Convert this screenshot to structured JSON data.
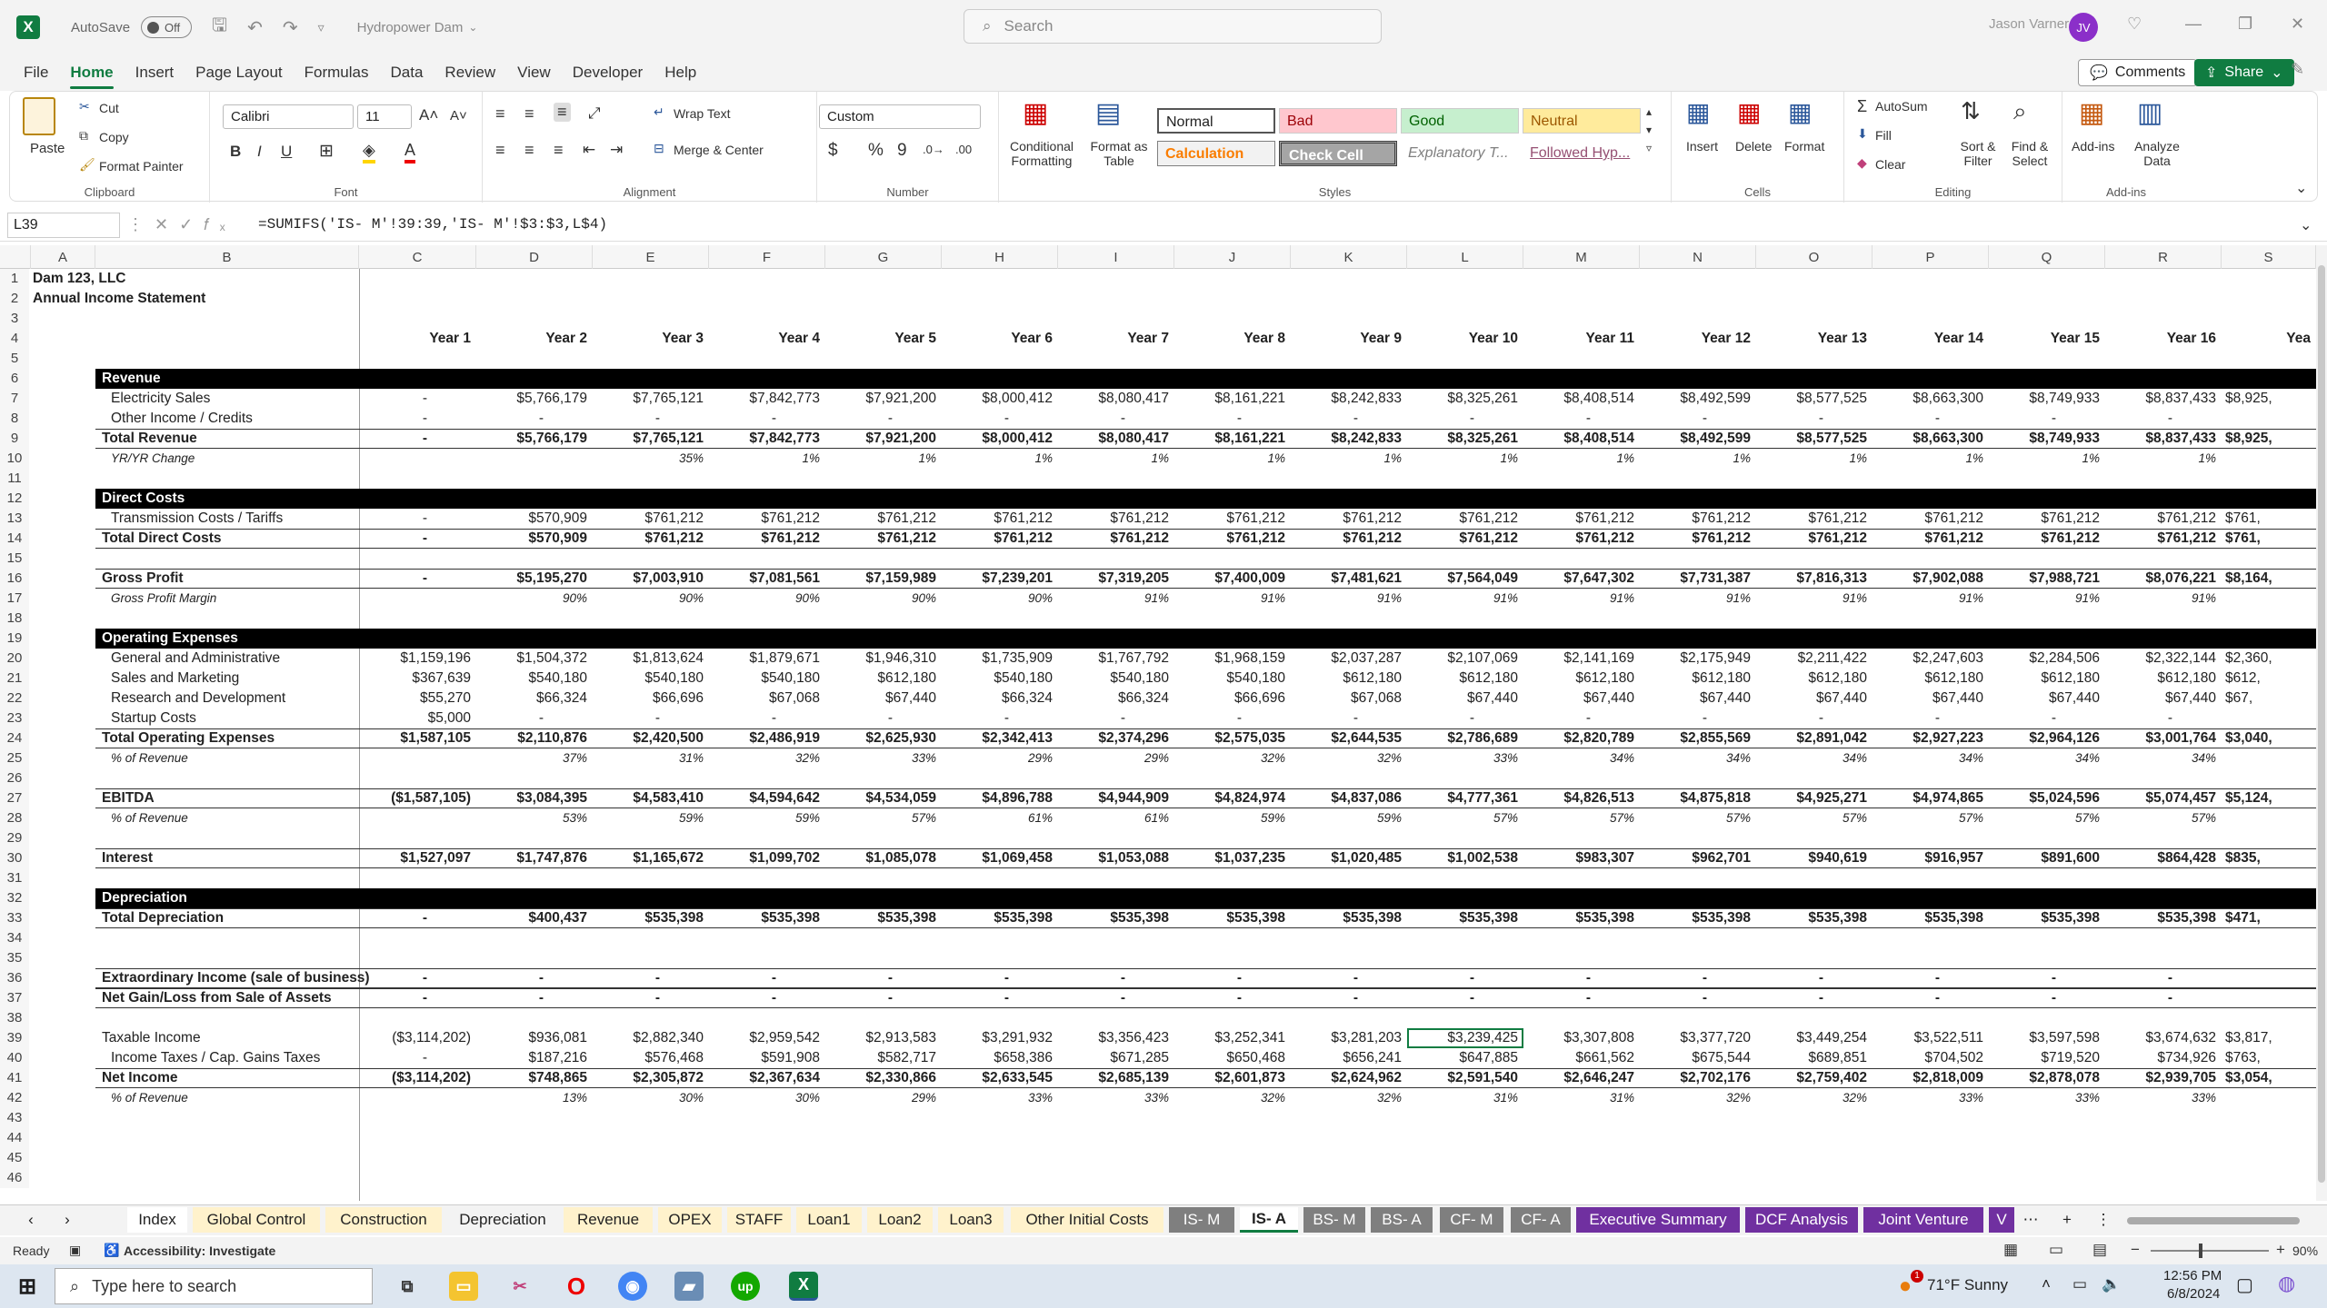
{
  "titlebar": {
    "autosave": "AutoSave",
    "toggle": "Off",
    "doc_title": "Hydropower Dam",
    "search": "Search",
    "user": "Jason Varner",
    "initials": "JV"
  },
  "menu": [
    "File",
    "Home",
    "Insert",
    "Page Layout",
    "Formulas",
    "Data",
    "Review",
    "View",
    "Developer",
    "Help"
  ],
  "menu_right": {
    "comments": "Comments",
    "share": "Share"
  },
  "ribbon": {
    "clipboard": {
      "paste": "Paste",
      "cut": "Cut",
      "copy": "Copy",
      "format_painter": "Format Painter",
      "label": "Clipboard"
    },
    "font": {
      "name": "Calibri",
      "size": "11",
      "label": "Font"
    },
    "alignment": {
      "wrap": "Wrap Text",
      "merge": "Merge & Center",
      "label": "Alignment"
    },
    "number": {
      "format": "Custom",
      "label": "Number"
    },
    "styles": {
      "cond": "Conditional Formatting",
      "table": "Format as Table",
      "normal": "Normal",
      "bad": "Bad",
      "good": "Good",
      "neutral": "Neutral",
      "calculation": "Calculation",
      "check": "Check Cell",
      "explanatory": "Explanatory T...",
      "followed": "Followed Hyp...",
      "label": "Styles"
    },
    "cells": {
      "insert": "Insert",
      "delete": "Delete",
      "format": "Format",
      "label": "Cells"
    },
    "editing": {
      "autosum": "AutoSum",
      "fill": "Fill",
      "clear": "Clear",
      "sort": "Sort & Filter",
      "find": "Find & Select",
      "label": "Editing"
    },
    "addins": {
      "addins": "Add-ins",
      "analyze": "Analyze Data",
      "label": "Add-ins"
    }
  },
  "formula_bar": {
    "name_box": "L39",
    "formula": "=SUMIFS('IS- M'!39:39,'IS- M'!$3:$3,L$4)"
  },
  "columns": [
    "A",
    "B",
    "C",
    "D",
    "E",
    "F",
    "G",
    "H",
    "I",
    "J",
    "K",
    "L",
    "M",
    "N",
    "O",
    "P",
    "Q",
    "R",
    "S"
  ],
  "sheet": {
    "title1": "Dam 123, LLC",
    "title2": "Annual Income Statement",
    "years": [
      "Year 1",
      "Year 2",
      "Year 3",
      "Year 4",
      "Year 5",
      "Year 6",
      "Year 7",
      "Year 8",
      "Year 9",
      "Year 10",
      "Year 11",
      "Year 12",
      "Year 13",
      "Year 14",
      "Year 15",
      "Year 16",
      "Yea"
    ],
    "rows": [
      {
        "r": 6,
        "label": "Revenue",
        "kind": "header"
      },
      {
        "r": 7,
        "label": "Electricity Sales",
        "kind": "indent",
        "v": [
          "-",
          "$5,766,179",
          "$7,765,121",
          "$7,842,773",
          "$7,921,200",
          "$8,000,412",
          "$8,080,417",
          "$8,161,221",
          "$8,242,833",
          "$8,325,261",
          "$8,408,514",
          "$8,492,599",
          "$8,577,525",
          "$8,663,300",
          "$8,749,933",
          "$8,837,433",
          "$8,925,"
        ]
      },
      {
        "r": 8,
        "label": "Other Income / Credits",
        "kind": "indent",
        "v": [
          "-",
          "-",
          "-",
          "-",
          "-",
          "-",
          "-",
          "-",
          "-",
          "-",
          "-",
          "-",
          "-",
          "-",
          "-",
          "-",
          ""
        ]
      },
      {
        "r": 9,
        "label": "Total Revenue",
        "kind": "total",
        "v": [
          "-",
          "$5,766,179",
          "$7,765,121",
          "$7,842,773",
          "$7,921,200",
          "$8,000,412",
          "$8,080,417",
          "$8,161,221",
          "$8,242,833",
          "$8,325,261",
          "$8,408,514",
          "$8,492,599",
          "$8,577,525",
          "$8,663,300",
          "$8,749,933",
          "$8,837,433",
          "$8,925,"
        ]
      },
      {
        "r": 10,
        "label": "YR/YR Change",
        "kind": "pct",
        "v": [
          "",
          "",
          "35%",
          "1%",
          "1%",
          "1%",
          "1%",
          "1%",
          "1%",
          "1%",
          "1%",
          "1%",
          "1%",
          "1%",
          "1%",
          "1%",
          ""
        ]
      },
      {
        "r": 12,
        "label": "Direct Costs",
        "kind": "header"
      },
      {
        "r": 13,
        "label": "Transmission Costs / Tariffs",
        "kind": "indent",
        "v": [
          "-",
          "$570,909",
          "$761,212",
          "$761,212",
          "$761,212",
          "$761,212",
          "$761,212",
          "$761,212",
          "$761,212",
          "$761,212",
          "$761,212",
          "$761,212",
          "$761,212",
          "$761,212",
          "$761,212",
          "$761,212",
          "$761,"
        ]
      },
      {
        "r": 14,
        "label": "Total Direct Costs",
        "kind": "total",
        "v": [
          "-",
          "$570,909",
          "$761,212",
          "$761,212",
          "$761,212",
          "$761,212",
          "$761,212",
          "$761,212",
          "$761,212",
          "$761,212",
          "$761,212",
          "$761,212",
          "$761,212",
          "$761,212",
          "$761,212",
          "$761,212",
          "$761,"
        ]
      },
      {
        "r": 16,
        "label": "Gross Profit",
        "kind": "total",
        "v": [
          "-",
          "$5,195,270",
          "$7,003,910",
          "$7,081,561",
          "$7,159,989",
          "$7,239,201",
          "$7,319,205",
          "$7,400,009",
          "$7,481,621",
          "$7,564,049",
          "$7,647,302",
          "$7,731,387",
          "$7,816,313",
          "$7,902,088",
          "$7,988,721",
          "$8,076,221",
          "$8,164,"
        ]
      },
      {
        "r": 17,
        "label": "Gross Profit Margin",
        "kind": "pct",
        "v": [
          "",
          "90%",
          "90%",
          "90%",
          "90%",
          "90%",
          "91%",
          "91%",
          "91%",
          "91%",
          "91%",
          "91%",
          "91%",
          "91%",
          "91%",
          "91%",
          ""
        ]
      },
      {
        "r": 19,
        "label": "Operating Expenses",
        "kind": "header"
      },
      {
        "r": 20,
        "label": "General and Administrative",
        "kind": "indent",
        "v": [
          "$1,159,196",
          "$1,504,372",
          "$1,813,624",
          "$1,879,671",
          "$1,946,310",
          "$1,735,909",
          "$1,767,792",
          "$1,968,159",
          "$2,037,287",
          "$2,107,069",
          "$2,141,169",
          "$2,175,949",
          "$2,211,422",
          "$2,247,603",
          "$2,284,506",
          "$2,322,144",
          "$2,360,"
        ]
      },
      {
        "r": 21,
        "label": "Sales and Marketing",
        "kind": "indent",
        "v": [
          "$367,639",
          "$540,180",
          "$540,180",
          "$540,180",
          "$612,180",
          "$540,180",
          "$540,180",
          "$540,180",
          "$612,180",
          "$612,180",
          "$612,180",
          "$612,180",
          "$612,180",
          "$612,180",
          "$612,180",
          "$612,180",
          "$612,"
        ]
      },
      {
        "r": 22,
        "label": "Research and Development",
        "kind": "indent",
        "v": [
          "$55,270",
          "$66,324",
          "$66,696",
          "$67,068",
          "$67,440",
          "$66,324",
          "$66,324",
          "$66,696",
          "$67,068",
          "$67,440",
          "$67,440",
          "$67,440",
          "$67,440",
          "$67,440",
          "$67,440",
          "$67,440",
          "$67,"
        ]
      },
      {
        "r": 23,
        "label": "Startup Costs",
        "kind": "indent",
        "v": [
          "$5,000",
          "-",
          "-",
          "-",
          "-",
          "-",
          "-",
          "-",
          "-",
          "-",
          "-",
          "-",
          "-",
          "-",
          "-",
          "-",
          ""
        ]
      },
      {
        "r": 24,
        "label": "Total Operating Expenses",
        "kind": "total",
        "v": [
          "$1,587,105",
          "$2,110,876",
          "$2,420,500",
          "$2,486,919",
          "$2,625,930",
          "$2,342,413",
          "$2,374,296",
          "$2,575,035",
          "$2,644,535",
          "$2,786,689",
          "$2,820,789",
          "$2,855,569",
          "$2,891,042",
          "$2,927,223",
          "$2,964,126",
          "$3,001,764",
          "$3,040,"
        ]
      },
      {
        "r": 25,
        "label": "% of Revenue",
        "kind": "pct",
        "v": [
          "",
          "37%",
          "31%",
          "32%",
          "33%",
          "29%",
          "29%",
          "32%",
          "32%",
          "33%",
          "34%",
          "34%",
          "34%",
          "34%",
          "34%",
          "34%",
          ""
        ]
      },
      {
        "r": 27,
        "label": "EBITDA",
        "kind": "total",
        "v": [
          "($1,587,105)",
          "$3,084,395",
          "$4,583,410",
          "$4,594,642",
          "$4,534,059",
          "$4,896,788",
          "$4,944,909",
          "$4,824,974",
          "$4,837,086",
          "$4,777,361",
          "$4,826,513",
          "$4,875,818",
          "$4,925,271",
          "$4,974,865",
          "$5,024,596",
          "$5,074,457",
          "$5,124,"
        ]
      },
      {
        "r": 28,
        "label": "% of Revenue",
        "kind": "pct",
        "v": [
          "",
          "53%",
          "59%",
          "59%",
          "57%",
          "61%",
          "61%",
          "59%",
          "59%",
          "57%",
          "57%",
          "57%",
          "57%",
          "57%",
          "57%",
          "57%",
          ""
        ]
      },
      {
        "r": 30,
        "label": "Interest",
        "kind": "total",
        "v": [
          "$1,527,097",
          "$1,747,876",
          "$1,165,672",
          "$1,099,702",
          "$1,085,078",
          "$1,069,458",
          "$1,053,088",
          "$1,037,235",
          "$1,020,485",
          "$1,002,538",
          "$983,307",
          "$962,701",
          "$940,619",
          "$916,957",
          "$891,600",
          "$864,428",
          "$835,"
        ]
      },
      {
        "r": 32,
        "label": "Depreciation",
        "kind": "header"
      },
      {
        "r": 33,
        "label": "Total Depreciation",
        "kind": "total",
        "v": [
          "-",
          "$400,437",
          "$535,398",
          "$535,398",
          "$535,398",
          "$535,398",
          "$535,398",
          "$535,398",
          "$535,398",
          "$535,398",
          "$535,398",
          "$535,398",
          "$535,398",
          "$535,398",
          "$535,398",
          "$535,398",
          "$471,"
        ]
      },
      {
        "r": 36,
        "label": "Extraordinary Income (sale of business)",
        "kind": "total",
        "v": [
          "-",
          "-",
          "-",
          "-",
          "-",
          "-",
          "-",
          "-",
          "-",
          "-",
          "-",
          "-",
          "-",
          "-",
          "-",
          "-",
          ""
        ]
      },
      {
        "r": 37,
        "label": "Net Gain/Loss from Sale of Assets",
        "kind": "total",
        "v": [
          "-",
          "-",
          "-",
          "-",
          "-",
          "-",
          "-",
          "-",
          "-",
          "-",
          "-",
          "-",
          "-",
          "-",
          "-",
          "-",
          ""
        ]
      },
      {
        "r": 39,
        "label": "Taxable Income",
        "kind": "plain",
        "v": [
          "($3,114,202)",
          "$936,081",
          "$2,882,340",
          "$2,959,542",
          "$2,913,583",
          "$3,291,932",
          "$3,356,423",
          "$3,252,341",
          "$3,281,203",
          "$3,239,425",
          "$3,307,808",
          "$3,377,720",
          "$3,449,254",
          "$3,522,511",
          "$3,597,598",
          "$3,674,632",
          "$3,817,"
        ]
      },
      {
        "r": 40,
        "label": "Income Taxes / Cap. Gains Taxes",
        "kind": "indent",
        "v": [
          "-",
          "$187,216",
          "$576,468",
          "$591,908",
          "$582,717",
          "$658,386",
          "$671,285",
          "$650,468",
          "$656,241",
          "$647,885",
          "$661,562",
          "$675,544",
          "$689,851",
          "$704,502",
          "$719,520",
          "$734,926",
          "$763,"
        ]
      },
      {
        "r": 41,
        "label": "Net Income",
        "kind": "total",
        "v": [
          "($3,114,202)",
          "$748,865",
          "$2,305,872",
          "$2,367,634",
          "$2,330,866",
          "$2,633,545",
          "$2,685,139",
          "$2,601,873",
          "$2,624,962",
          "$2,591,540",
          "$2,646,247",
          "$2,702,176",
          "$2,759,402",
          "$2,818,009",
          "$2,878,078",
          "$2,939,705",
          "$3,054,"
        ]
      },
      {
        "r": 42,
        "label": "% of Revenue",
        "kind": "pct",
        "v": [
          "",
          "13%",
          "30%",
          "30%",
          "29%",
          "33%",
          "33%",
          "32%",
          "32%",
          "31%",
          "31%",
          "32%",
          "32%",
          "33%",
          "33%",
          "33%",
          ""
        ]
      }
    ]
  },
  "tabs": [
    {
      "label": "Index",
      "bg": "#ffffff",
      "fg": "#222222"
    },
    {
      "label": "Global Control",
      "bg": "#fff2cc",
      "fg": "#222222"
    },
    {
      "label": "Construction",
      "bg": "#fff2cc",
      "fg": "#222222"
    },
    {
      "label": "Depreciation",
      "bg": "#f3f3f3",
      "fg": "#222222"
    },
    {
      "label": "Revenue",
      "bg": "#fff2cc",
      "fg": "#222222"
    },
    {
      "label": "OPEX",
      "bg": "#fff2cc",
      "fg": "#222222"
    },
    {
      "label": "STAFF",
      "bg": "#fff2cc",
      "fg": "#222222"
    },
    {
      "label": "Loan1",
      "bg": "#fff2cc",
      "fg": "#222222"
    },
    {
      "label": "Loan2",
      "bg": "#fff2cc",
      "fg": "#222222"
    },
    {
      "label": "Loan3",
      "bg": "#fff2cc",
      "fg": "#222222"
    },
    {
      "label": "Other Initial Costs",
      "bg": "#fff2cc",
      "fg": "#222222"
    },
    {
      "label": "IS- M",
      "bg": "#7f7f7f",
      "fg": "#ffffff"
    },
    {
      "label": "IS- A",
      "bg": "#ffffff",
      "fg": "#222222"
    },
    {
      "label": "BS- M",
      "bg": "#7f7f7f",
      "fg": "#ffffff"
    },
    {
      "label": "BS- A",
      "bg": "#7f7f7f",
      "fg": "#ffffff"
    },
    {
      "label": "CF- M",
      "bg": "#7f7f7f",
      "fg": "#ffffff"
    },
    {
      "label": "CF- A",
      "bg": "#7f7f7f",
      "fg": "#ffffff"
    },
    {
      "label": "Executive Summary",
      "bg": "#7030a0",
      "fg": "#ffffff"
    },
    {
      "label": "DCF Analysis",
      "bg": "#7030a0",
      "fg": "#ffffff"
    },
    {
      "label": "Joint Venture",
      "bg": "#7030a0",
      "fg": "#ffffff"
    },
    {
      "label": "V",
      "bg": "#7030a0",
      "fg": "#ffffff"
    }
  ],
  "status": {
    "ready": "Ready",
    "accessibility": "Accessibility: Investigate",
    "zoom": "90%"
  },
  "taskbar": {
    "search": "Type here to search",
    "weather": "71°F  Sunny",
    "time": "12:56 PM",
    "date": "6/8/2024",
    "notif": "1"
  }
}
